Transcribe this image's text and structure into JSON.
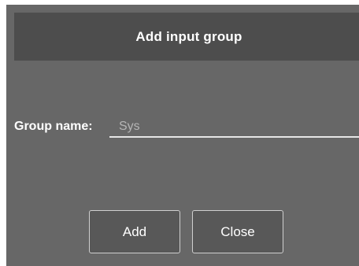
{
  "dialog": {
    "title": "Add input group",
    "group_name": {
      "label": "Group name:",
      "value": "Sys"
    },
    "buttons": {
      "add_label": "Add",
      "close_label": "Close"
    }
  }
}
